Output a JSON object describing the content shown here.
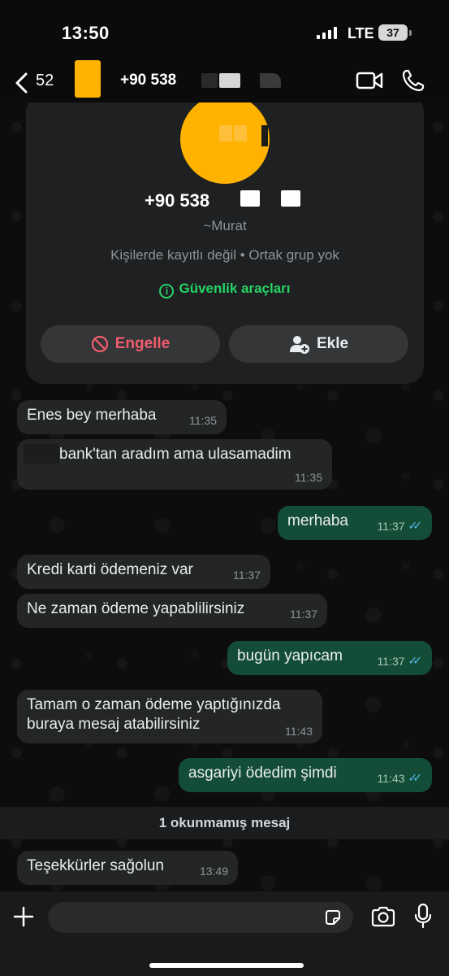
{
  "status_bar": {
    "time": "13:50",
    "network": "LTE",
    "battery": "37"
  },
  "header": {
    "back_count": "52",
    "contact_number": "+90 538"
  },
  "contact_card": {
    "phone": "+90 538",
    "alias": "~Murat",
    "info": "Kişilerde kayıtlı değil • Ortak grup yok",
    "security_label": "Güvenlik araçları",
    "block_label": "Engelle",
    "add_label": "Ekle"
  },
  "messages": [
    {
      "direction": "in",
      "text": "Enes bey merhaba",
      "time": "11:35"
    },
    {
      "direction": "in",
      "text": "bank'tan aradım ama ulasamadim",
      "time": "11:35"
    },
    {
      "direction": "out",
      "text": "merhaba",
      "time": "11:37",
      "read": true
    },
    {
      "direction": "in",
      "text": "Kredi karti ödemeniz var",
      "time": "11:37"
    },
    {
      "direction": "in",
      "text": "Ne zaman ödeme yapablilirsiniz",
      "time": "11:37"
    },
    {
      "direction": "out",
      "text": "bugün yapıcam",
      "time": "11:37",
      "read": true
    },
    {
      "direction": "in",
      "text_line1": "Tamam o zaman ödeme yaptığınızda",
      "text_line2": "buraya mesaj atabilirsiniz",
      "time": "11:43"
    },
    {
      "direction": "out",
      "text": "asgariyi ödedim şimdi",
      "time": "11:43",
      "read": true
    },
    {
      "direction": "in",
      "text": "Teşekkürler sağolun",
      "time": "13:49"
    }
  ],
  "unread_banner": "1 okunmamış mesaj",
  "colors": {
    "accent_green": "#25d366",
    "outgoing_bubble": "#144d37",
    "incoming_bubble": "#242626",
    "read_ticks": "#53bdeb",
    "block_red": "#f15c6d",
    "avatar": "#ffb300"
  },
  "icons": [
    "back-icon",
    "video-call-icon",
    "phone-call-icon",
    "info-icon",
    "block-icon",
    "add-contact-icon",
    "plus-icon",
    "sticker-icon",
    "camera-icon",
    "microphone-icon"
  ]
}
